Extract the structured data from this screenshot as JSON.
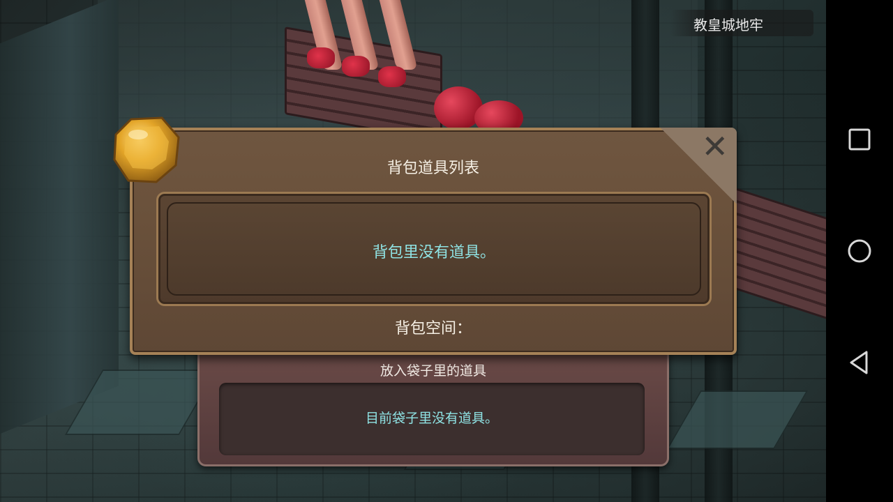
{
  "location": {
    "name": "教皇城地牢"
  },
  "inventory_panel": {
    "title": "背包道具列表",
    "empty_message": "背包里没有道具。",
    "space_label": "背包空间："
  },
  "bag_panel": {
    "title": "放入袋子里的道具",
    "empty_message": "目前袋子里没有道具。"
  },
  "close_button": {
    "icon": "close-icon",
    "glyph": "✕"
  },
  "nav_bar": {
    "buttons": [
      {
        "icon": "recents-square-icon"
      },
      {
        "icon": "home-circle-icon"
      },
      {
        "icon": "back-triangle-icon"
      }
    ]
  },
  "colors": {
    "panel_bg": "#6a513b",
    "panel_border": "#a68257",
    "empty_text": "#8fe3e4",
    "label_text": "#f5efe4"
  }
}
